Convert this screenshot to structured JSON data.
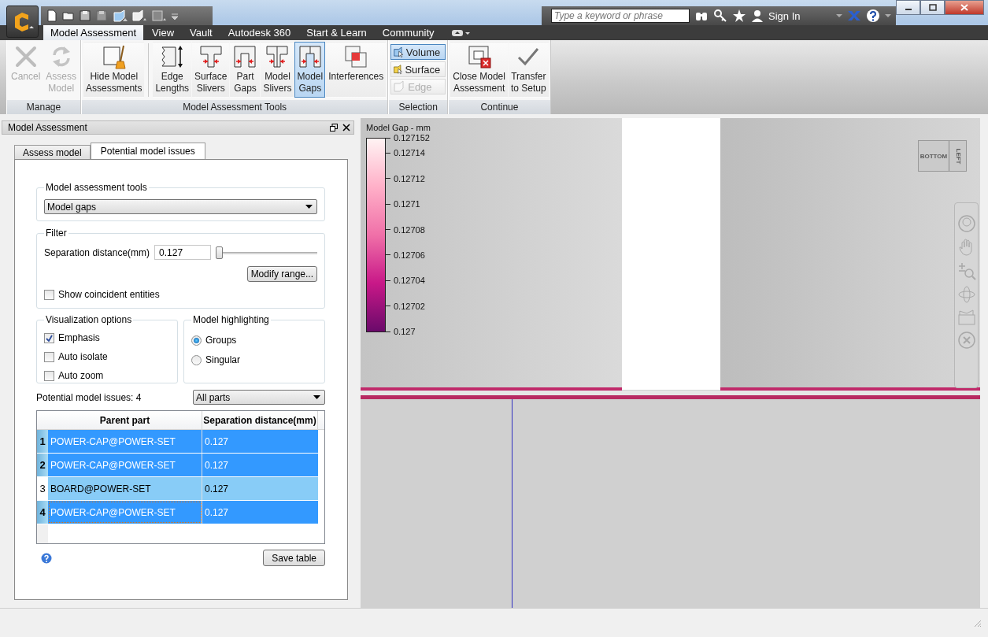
{
  "title_bar": {
    "search": {
      "placeholder": "Type a keyword or phrase"
    },
    "sign_in": "Sign In"
  },
  "ribbon_tabs": [
    {
      "label": "Model Assessment",
      "selected": true
    },
    {
      "label": "View",
      "selected": false
    },
    {
      "label": "Vault",
      "selected": false
    },
    {
      "label": "Autodesk 360",
      "selected": false
    },
    {
      "label": "Start & Learn",
      "selected": false
    },
    {
      "label": "Community",
      "selected": false
    }
  ],
  "ribbon_groups": [
    {
      "title": "Manage",
      "buttons": [
        {
          "kind": "cancel",
          "lines": [
            "Cancel"
          ],
          "selected": false,
          "disabled": true
        },
        {
          "kind": "assess",
          "lines": [
            "Assess",
            "Model"
          ],
          "selected": false,
          "disabled": true
        }
      ]
    },
    {
      "title": "Model Assessment Tools",
      "buttons": [
        {
          "kind": "hide",
          "lines": [
            "Hide Model",
            "Assessments"
          ],
          "selected": false,
          "disabled": false
        },
        {
          "kind": "edge",
          "lines": [
            "Edge",
            "Lengths"
          ],
          "selected": false,
          "disabled": false
        },
        {
          "kind": "surface_sliver",
          "lines": [
            "Surface",
            "Slivers"
          ],
          "selected": false,
          "disabled": false
        },
        {
          "kind": "part_gap",
          "lines": [
            "Part",
            "Gaps"
          ],
          "selected": false,
          "disabled": false
        },
        {
          "kind": "model_sliver",
          "lines": [
            "Model",
            "Slivers"
          ],
          "selected": false,
          "disabled": false
        },
        {
          "kind": "model_gap",
          "lines": [
            "Model",
            "Gaps"
          ],
          "selected": true,
          "disabled": false
        },
        {
          "kind": "interference",
          "lines": [
            "Interferences"
          ],
          "selected": false,
          "disabled": false
        }
      ]
    },
    {
      "title": "Selection",
      "buttons": [
        {
          "kind": "volume",
          "lines": [
            "Volume"
          ],
          "selected": true,
          "disabled": false
        },
        {
          "kind": "surface",
          "lines": [
            "Surface"
          ],
          "selected": false,
          "disabled": false
        },
        {
          "kind": "edge_select",
          "lines": [
            "Edge"
          ],
          "selected": false,
          "disabled": true
        }
      ]
    },
    {
      "title": "Continue",
      "buttons": [
        {
          "kind": "close",
          "lines": [
            "Close Model",
            "Assessment"
          ],
          "selected": false,
          "disabled": false
        },
        {
          "kind": "transfer",
          "lines": [
            "Transfer",
            "to Setup"
          ],
          "selected": false,
          "disabled": false
        }
      ]
    }
  ],
  "panel": {
    "title": "Model Assessment",
    "tabs": [
      {
        "label": "Assess model",
        "selected": false
      },
      {
        "label": "Potential model issues",
        "selected": true
      }
    ],
    "tools": {
      "title": "Model assessment tools",
      "value": "Model gaps"
    },
    "filter": {
      "title": "Filter",
      "label": "Separation distance(mm)",
      "value": "0.127",
      "level": 0,
      "button": "Modify range...",
      "checkbox": {
        "label": "Show coincident entities",
        "checked": false
      }
    },
    "visualization": {
      "title": "Visualization options",
      "options": [
        {
          "label": "Emphasis",
          "checked": true
        },
        {
          "label": "Auto isolate",
          "checked": false
        },
        {
          "label": "Auto zoom",
          "checked": false
        }
      ]
    },
    "highlighting": {
      "title": "Model highlighting",
      "options": [
        {
          "label": "Groups",
          "selected": true
        },
        {
          "label": "Singular",
          "selected": false
        }
      ]
    },
    "issues_count": "Potential model issues: 4",
    "parts_filter": "All parts",
    "table": {
      "columns": [
        "Parent part",
        "Separation distance(mm)"
      ],
      "rows": [
        {
          "index": "1",
          "part": "POWER-CAP@POWER-SET",
          "distance": "0.127",
          "selected": true,
          "focused": false
        },
        {
          "index": "2",
          "part": "POWER-CAP@POWER-SET",
          "distance": "0.127",
          "selected": true,
          "focused": false
        },
        {
          "index": "3",
          "part": "BOARD@POWER-SET",
          "distance": "0.127",
          "selected": false,
          "focused": false
        },
        {
          "index": "4",
          "part": "POWER-CAP@POWER-SET",
          "distance": "0.127",
          "selected": true,
          "focused": true
        }
      ]
    },
    "save_button": "Save table"
  },
  "viewport": {
    "legend": {
      "title": "Model Gap - mm",
      "ticks": [
        "0.127152",
        "0.12714",
        "0.12712",
        "0.1271",
        "0.12708",
        "0.12706",
        "0.12704",
        "0.12702",
        "0.127"
      ]
    },
    "view_cube": {
      "faces": [
        "BOTTOM",
        "LEFT"
      ]
    }
  }
}
